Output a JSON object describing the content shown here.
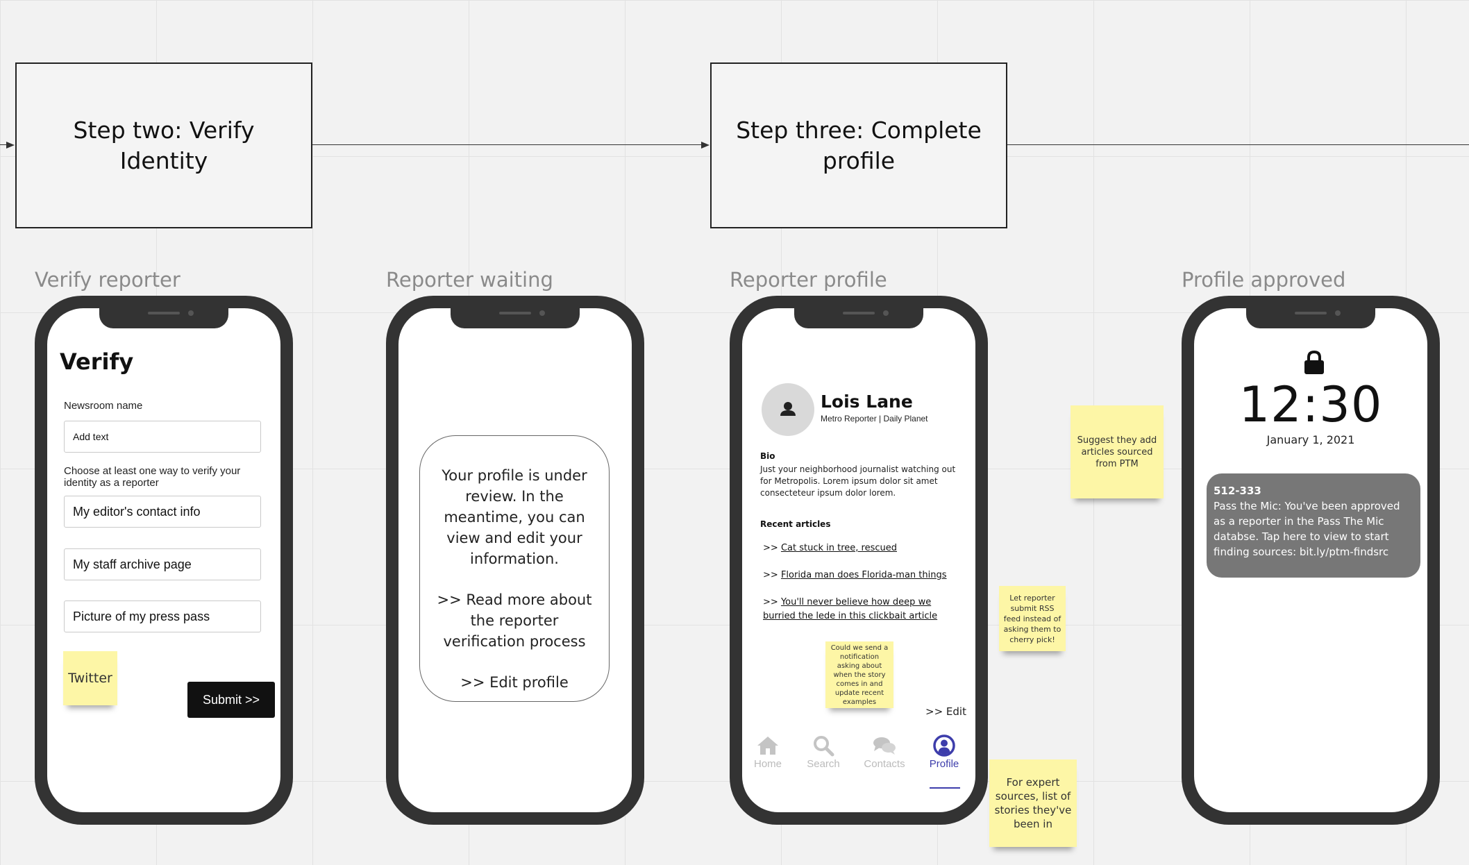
{
  "flow": {
    "step_two": "Step two: Verify Identity",
    "step_three": "Step three: Complete profile"
  },
  "labels": {
    "verify": "Verify reporter",
    "waiting": "Reporter waiting",
    "profile": "Reporter profile",
    "approved": "Profile approved"
  },
  "verify_screen": {
    "title": "Verify",
    "newsroom_label": "Newsroom name",
    "newsroom_placeholder": "Add text",
    "choose_label": "Choose at least one way to verify your identity as a reporter",
    "options": [
      "My editor's contact info",
      "My staff archive page",
      "Picture of my press pass"
    ],
    "submit": "Submit >>"
  },
  "waiting_screen": {
    "message": "Your profile is under review. In the meantime, you can view and edit your information.",
    "read_more": ">> Read more about the reporter verification process",
    "edit": ">> Edit profile"
  },
  "profile_screen": {
    "name": "Lois Lane",
    "role": "Metro Reporter | Daily Planet",
    "bio_heading": "Bio",
    "bio": "Just your neighborhood journalist watching out for Metropolis. Lorem ipsum dolor sit amet consecteteur ipsum dolor lorem.",
    "articles_heading": "Recent articles",
    "article_prefix": ">>",
    "articles": [
      "Cat stuck in tree, rescued",
      "Florida man does Florida-man things",
      "You'll never believe how deep we burried the lede in this clickbait article"
    ],
    "edit": ">> Edit",
    "nav": [
      {
        "label": "Home",
        "icon": "home-icon"
      },
      {
        "label": "Search",
        "icon": "search-icon"
      },
      {
        "label": "Contacts",
        "icon": "chat-icon"
      },
      {
        "label": "Profile",
        "icon": "user-circle-icon"
      }
    ],
    "active_nav": "Profile",
    "accent": "#3d3dab"
  },
  "lock_screen": {
    "time": "12:30",
    "date": "January 1, 2021",
    "notif_title": "512-333",
    "notif_body": "Pass the Mic: You've been approved as a reporter in the Pass The Mic databse. Tap here to view to start finding sources: bit.ly/ptm-findsrc"
  },
  "stickies": {
    "twitter": "Twitter",
    "notify": "Could we send a notification asking about when the story comes in and update recent examples",
    "rss": "Let reporter submit RSS feed instead of asking them to cherry pick!",
    "suggest": "Suggest they add articles sourced from PTM",
    "expert": "For expert sources, list of stories they've been in"
  },
  "colors": {
    "sticky": "#fdf6a6",
    "phone_frame": "#333333",
    "canvas": "#f2f2f2"
  }
}
